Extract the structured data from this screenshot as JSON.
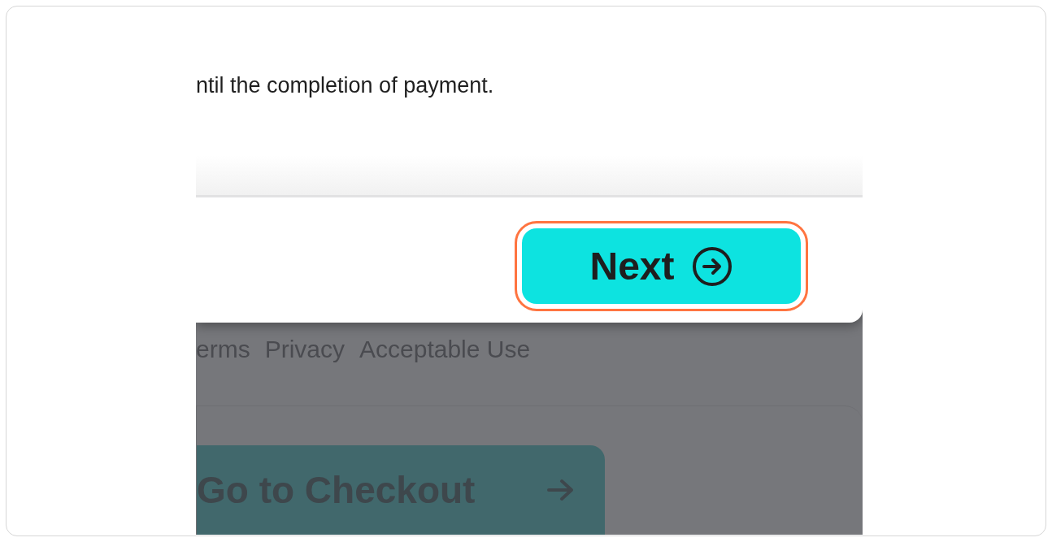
{
  "modal": {
    "body_text": "ntil the completion of payment.",
    "next_button": {
      "label": "Next",
      "highlighted": true
    }
  },
  "footer_links": [
    "erms",
    "Privacy",
    "Acceptable Use"
  ],
  "checkout_button": {
    "label": "Go to Checkout"
  }
}
